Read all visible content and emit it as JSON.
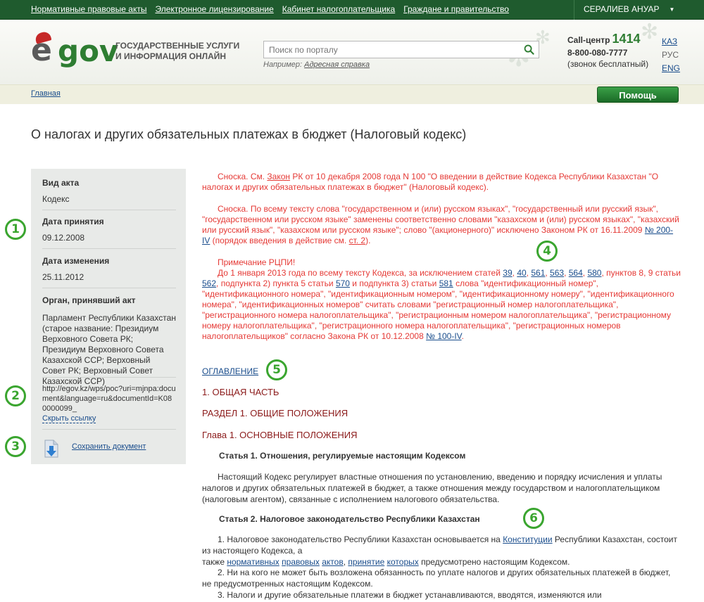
{
  "topbar": {
    "links": [
      "Нормативные правовые акты",
      "Электронное лицензирование",
      "Кабинет налогоплательщика",
      "Граждане и правительство"
    ],
    "user": "СЕРАЛИЕВ АНУАР"
  },
  "header": {
    "logo_e": "e",
    "logo_gov": "gov",
    "tagline_line1": "ГОСУДАРСТВЕННЫЕ УСЛУГИ",
    "tagline_line2": "И ИНФОРМАЦИЯ ОНЛАЙН",
    "search_placeholder": "Поиск по порталу",
    "example_label": "Например:",
    "example_link": "Адресная справка",
    "callcenter_label": "Call-центр",
    "callcenter_number": "1414",
    "phone": "8-800-080-7777",
    "free_note": "(звонок бесплатный)",
    "languages": [
      "КАЗ",
      "РУС",
      "ENG"
    ],
    "active_language": "РУС"
  },
  "breadcrumb": {
    "home": "Главная"
  },
  "help_button": "Помощь",
  "page_title": "О налогах и других обязательных платежах в бюджет (Налоговый кодекс)",
  "sidebar": {
    "act_type_label": "Вид акта",
    "act_type_value": "Кодекс",
    "adopted_label": "Дата принятия",
    "adopted_value": "09.12.2008",
    "changed_label": "Дата изменения",
    "changed_value": "25.11.2012",
    "organ_label": "Орган, принявший акт",
    "organ_value": "Парламент Республики Казахстан (старое название: Президиум Верховного Совета РК; Президиум Верховного Совета Казахской ССР; Верховный Совет РК; Верховный Совет Казахской ССР)",
    "url": "http://egov.kz/wps/poc?uri=mjnpa:document&language=ru&documentId=K080000099_",
    "hide_link": "Скрыть ссылку",
    "save_link": "Сохранить документ"
  },
  "markers": [
    "1",
    "2",
    "3",
    "4",
    "5",
    "6"
  ],
  "content": {
    "note1_a": "Сноска. См. ",
    "note1_link": "Закон",
    "note1_b": " РК от 10 декабря 2008 года N 100 \"О введении в действие Кодекса Республики Казахстан \"О налогах и других обязательных платежах в бюджет\" (Налоговый кодекс).",
    "note2_a": "Сноска. По всему тексту слова \"государственном и (или) русском языках\", \"государственный или русский язык\", \"государственном или русском языке\" заменены соответственно словами \"казахском и (или) русском языках\", \"казахский или русский язык\", \"казахском или русском языке\"; слово \"(акционерного)\" исключено Законом РК от 16.11.2009 ",
    "note2_link": "№ 200-IV",
    "note2_b": " (порядок введения в действие см. ",
    "note2_link2": "ст. 2",
    "note2_c": ").",
    "note3_title": "Примечание РЦПИ!",
    "note3_a": "До 1 января 2013 года по всему тексту Кодекса, за исключением статей ",
    "note3_l1": "39",
    "note3_l2": "40",
    "note3_l3": "561",
    "note3_l4": "563",
    "note3_l5": "564",
    "note3_l6": "580",
    "note3_b": ", пунктов 8, 9 статьи ",
    "note3_l7": "562",
    "note3_c": ", подпункта 2) пункта 5 статьи ",
    "note3_l8": "570",
    "note3_d": " и подпункта 3) статьи ",
    "note3_l9": "581",
    "note3_e": " слова \"идентификационный номер\", \"идентификационного номера\", \"идентификационным номером\", \"идентификационному номеру\", \"идентификационного номера\", \"идентификационных номеров\" считать словами \"регистрационный номер налогоплательщика\", \"регистрационного номера налогоплательщика\", \"регистрационным номером налогоплательщика\", \"регистрационному номеру налогоплательщика\", \"регистрационного номера налогоплательщика\", \"регистрационных номеров налогоплательщиков\" согласно Закона РК от 10.12.2008 ",
    "note3_l10": "№ 100-IV",
    "note3_f": ".",
    "toc": "ОГЛАВЛЕНИЕ",
    "part1": "1. ОБЩАЯ ЧАСТЬ",
    "section1": "РАЗДЕЛ 1. ОБЩИЕ ПОЛОЖЕНИЯ",
    "chapter1": "Глава 1. ОСНОВНЫЕ ПОЛОЖЕНИЯ",
    "article1_title": "Статья 1. Отношения, регулируемые настоящим Кодексом",
    "article1_text": "Настоящий Кодекс регулирует властные отношения по установлению, введению и порядку исчисления и уплаты налогов и других обязательных платежей в бюджет, а также отношения между государством и налогоплательщиком (налоговым агентом), связанные с исполнением налогового обязательства.",
    "article2_title": "Статья 2. Налоговое законодательство Республики Казахстан",
    "a2p1_a": "1. Налоговое законодательство Республики Казахстан основывается на ",
    "a2p1_link": "Конституции",
    "a2p1_b": " Республики Казахстан, состоит из настоящего Кодекса, а",
    "a2p1_c": "также ",
    "a2p1_l1": "нормативных",
    "a2p1_l2": "правовых",
    "a2p1_l3": "актов",
    "a2p1_l4": "принятие",
    "a2p1_l5": "которых",
    "a2p1_d": " предусмотрено настоящим Кодексом.",
    "a2p2": "2. Ни на кого не может быть возложена обязанность по уплате налогов и других обязательных платежей в бюджет, не предусмотренных настоящим Кодексом.",
    "a2p3": "3. Налоги и другие обязательные платежи в бюджет устанавливаются, вводятся, изменяются или"
  },
  "colors": {
    "topbar": "#1f5b2e",
    "accent_green": "#2e7d32",
    "note_red": "#e53935",
    "link_blue": "#1a4d8c",
    "marker_green": "#3aa52f"
  }
}
